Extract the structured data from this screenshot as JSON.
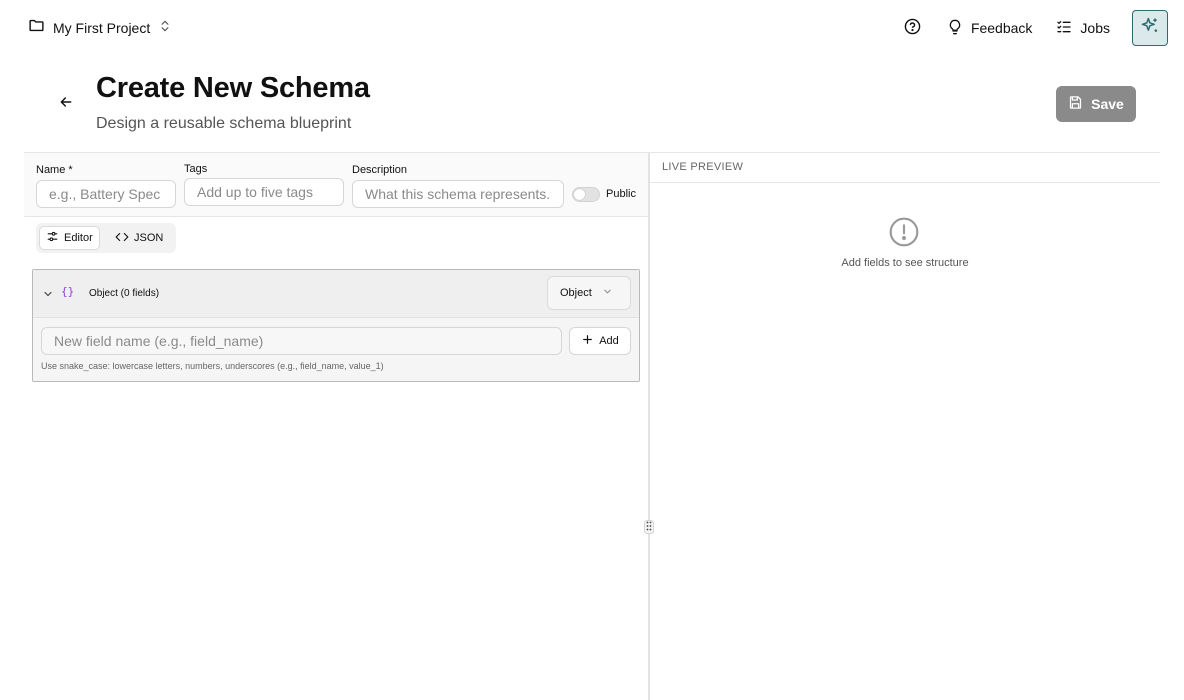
{
  "topbar": {
    "project_name": "My First Project",
    "feedback_label": "Feedback",
    "jobs_label": "Jobs"
  },
  "header": {
    "title": "Create New Schema",
    "subtitle": "Design a reusable schema blueprint",
    "save_label": "Save"
  },
  "form": {
    "name_label": "Name *",
    "name_placeholder": "e.g., Battery Spec",
    "tags_label": "Tags",
    "tags_placeholder": "Add up to five tags",
    "description_label": "Description",
    "description_placeholder": "What this schema represents.",
    "public_label": "Public",
    "public_enabled": false
  },
  "mode_tabs": {
    "editor_label": "Editor",
    "json_label": "JSON",
    "active": "Editor"
  },
  "schema_root": {
    "braces": "{}",
    "title": "Object (0 fields)",
    "type_value": "Object",
    "field_placeholder": "New field name (e.g., field_name)",
    "add_label": "Add",
    "hint": "Use snake_case: lowercase letters, numbers, underscores (e.g., field_name, value_1)"
  },
  "preview": {
    "title": "LIVE PREVIEW",
    "empty_text": "Add fields to see structure"
  },
  "colors": {
    "accent": "#2d6b72",
    "accent_bg": "#dbe9ea",
    "save_bg": "#8a8a8a",
    "braces": "#8b3fd1"
  }
}
